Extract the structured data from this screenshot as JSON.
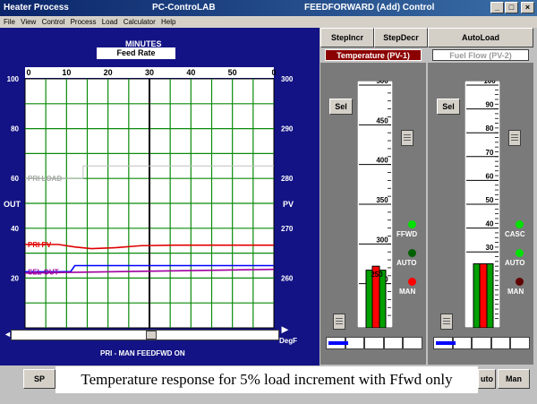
{
  "window": {
    "app_title": "Heater Process",
    "center_title": "PC-ControLAB",
    "right_title": "FEEDFORWARD (Add) Control",
    "min": "_",
    "max": "□",
    "close": "×"
  },
  "menu": [
    "File",
    "View",
    "Control",
    "Process",
    "Load",
    "Calculator",
    "Help"
  ],
  "trend": {
    "minutes_label": "MINUTES",
    "feed_rate_label": "Feed Rate",
    "time_ticks": [
      "0",
      "10",
      "20",
      "30",
      "40",
      "50",
      "0"
    ],
    "out_ticks": [
      "100",
      "80",
      "60",
      "40",
      "20"
    ],
    "pv_ticks": [
      "300",
      "290",
      "280",
      "270",
      "260"
    ],
    "out_label": "OUT",
    "pv_label": "PV",
    "degf": "DegF",
    "series_labels": {
      "preload": "PRI LOAD",
      "pripv": "PRI PV",
      "seldv": "SEL OUT"
    },
    "status": "PRI - MAN   FEEDFWD ON"
  },
  "buttons": {
    "step_incr": "StepIncr",
    "step_decr": "StepDecr",
    "auto_load": "AutoLoad",
    "sp": "SP",
    "man": "Man",
    "auto_partial": "uto",
    "sel": "Sel"
  },
  "pv1": {
    "tag": "Temperature  (PV-1)",
    "scale": [
      "500",
      "450",
      "400",
      "350",
      "300",
      "250"
    ],
    "bar_value": "250",
    "modes": [
      "FFWD",
      "AUTO",
      "MAN"
    ]
  },
  "pv2": {
    "tag": "Fuel Flow  (PV-2)",
    "scale": [
      "100",
      "90",
      "80",
      "70",
      "60",
      "50",
      "40",
      "30"
    ],
    "modes": [
      "CASC",
      "AUTO",
      "MAN"
    ]
  },
  "caption": "Temperature response for 5% load increment with Ffwd only",
  "chart_data": {
    "type": "line",
    "xlabel": "MINUTES",
    "xlim": [
      0,
      60
    ],
    "ylim_left": [
      0,
      100
    ],
    "ylim_right": [
      250,
      300
    ],
    "series": [
      {
        "name": "PRI LOAD",
        "color": "#c0c0c0",
        "x": [
          0,
          14,
          14,
          60
        ],
        "y": [
          60,
          60,
          65,
          65
        ]
      },
      {
        "name": "PRI PV",
        "color": "#e00000",
        "x": [
          0,
          8,
          12,
          16,
          22,
          28,
          36,
          60
        ],
        "y": [
          33.5,
          33.5,
          32.5,
          31.8,
          32.2,
          33.0,
          33.2,
          33.2
        ]
      },
      {
        "name": "SEL OUT",
        "color": "#0000ff",
        "x": [
          0,
          8,
          11,
          12,
          60
        ],
        "y": [
          22.5,
          22.5,
          22.6,
          25.0,
          25.0
        ]
      },
      {
        "name": "",
        "color": "#a000a0",
        "x": [
          0,
          60
        ],
        "y": [
          22.0,
          23.5
        ]
      }
    ]
  },
  "colors": {
    "grid_green": "#0a8a0a",
    "panel_blue": "#131385",
    "tag_red": "#8b0000"
  }
}
